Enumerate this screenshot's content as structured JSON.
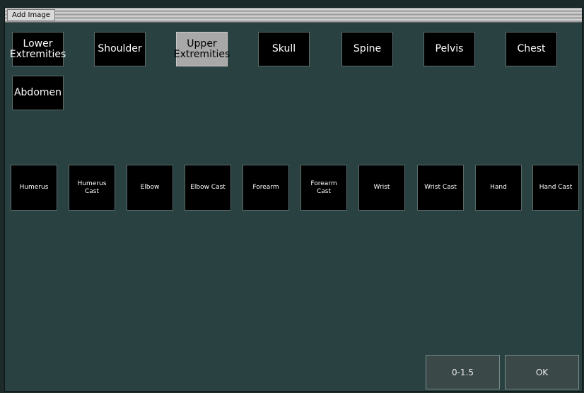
{
  "window": {
    "title": "Add Image"
  },
  "categories": [
    {
      "label": "Lower\nExtremities",
      "active": false
    },
    {
      "label": "Shoulder",
      "active": false
    },
    {
      "label": "Upper\nExtremities",
      "active": true
    },
    {
      "label": "Skull",
      "active": false
    },
    {
      "label": "Spine",
      "active": false
    },
    {
      "label": "Pelvis",
      "active": false
    },
    {
      "label": "Chest",
      "active": false
    },
    {
      "label": "Abdomen",
      "active": false
    }
  ],
  "views": [
    {
      "label": "Humerus"
    },
    {
      "label": "Humerus\nCast"
    },
    {
      "label": "Elbow"
    },
    {
      "label": "Elbow Cast"
    },
    {
      "label": "Forearm"
    },
    {
      "label": "Forearm\nCast"
    },
    {
      "label": "Wrist"
    },
    {
      "label": "Wrist Cast"
    },
    {
      "label": "Hand"
    },
    {
      "label": "Hand Cast"
    }
  ],
  "footer": {
    "range_label": "0-1.5",
    "ok_label": "OK"
  },
  "colors": {
    "background": "#294141",
    "button": "#000000",
    "active_button": "#a8a8a8",
    "footer_button": "#3b4848"
  }
}
